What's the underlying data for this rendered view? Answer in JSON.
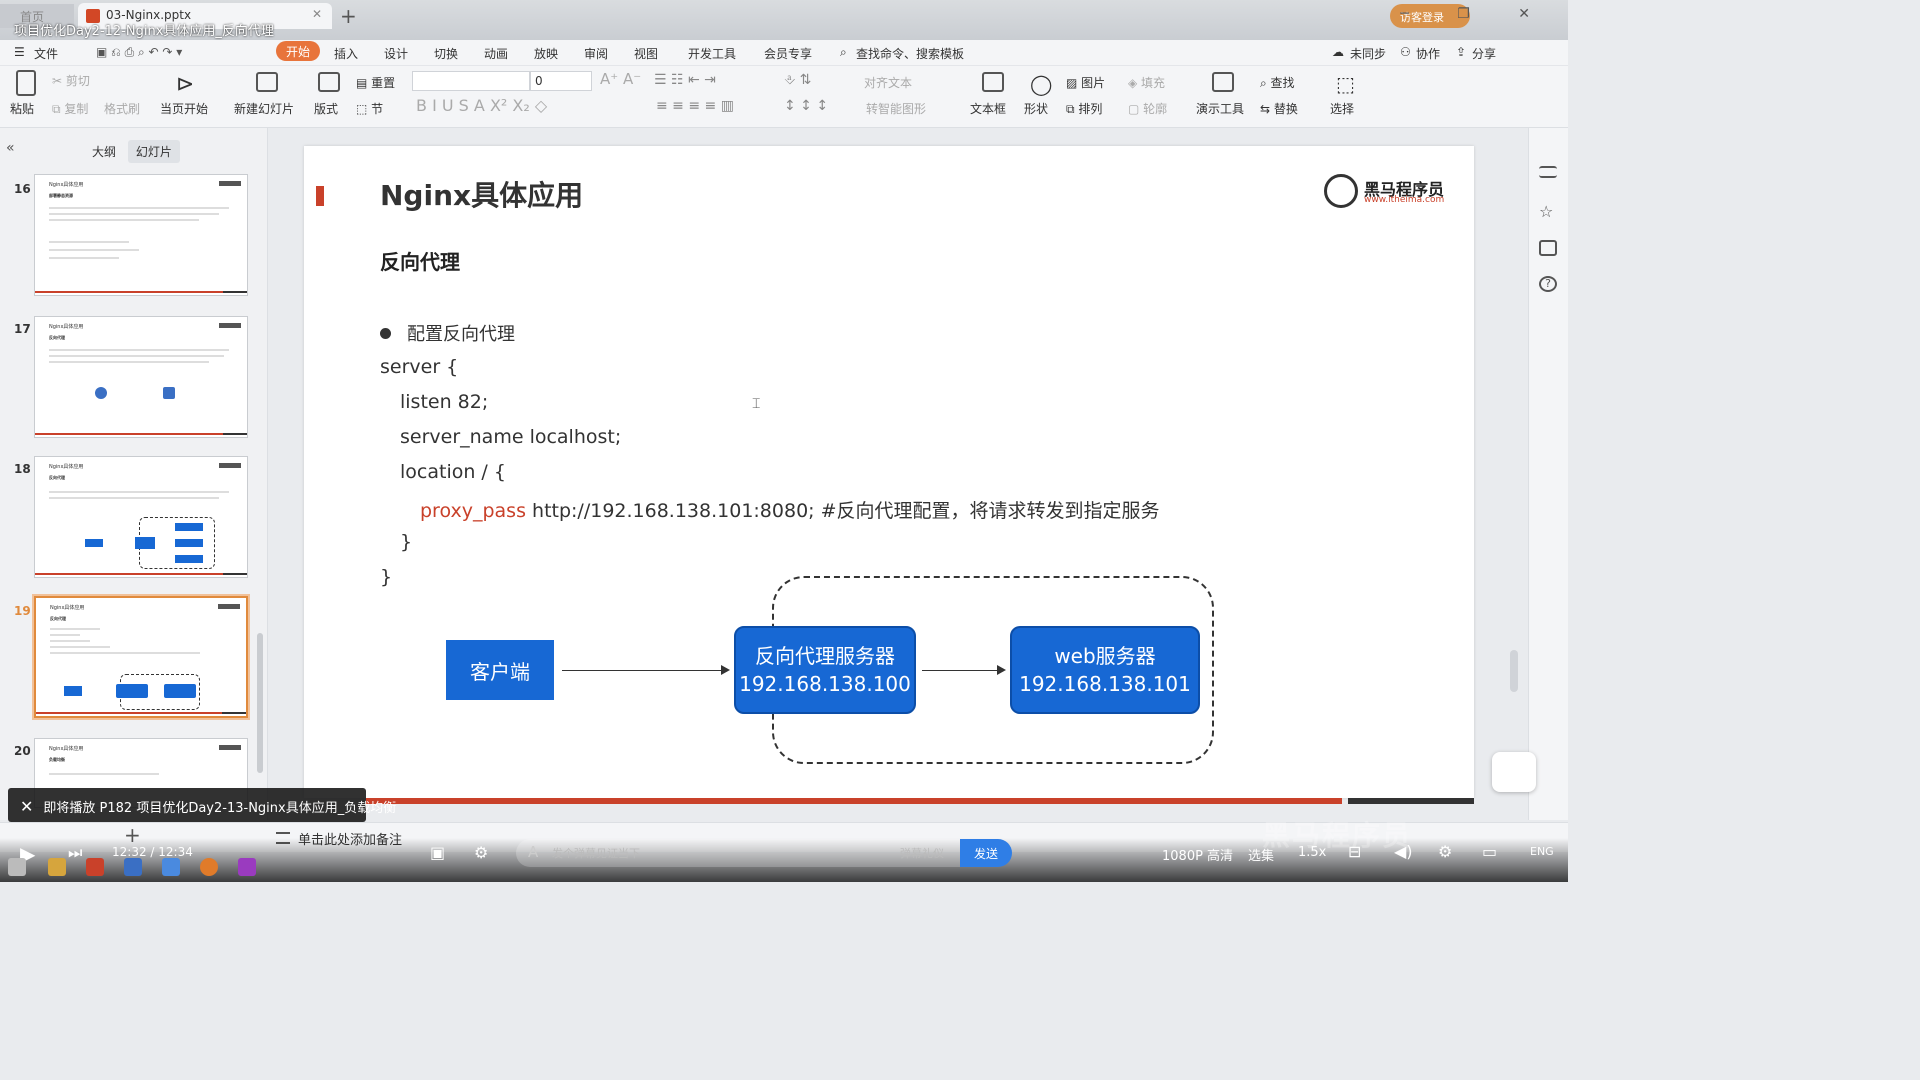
{
  "window": {
    "home_tab": "首页",
    "doc_tab": "03-Nginx.pptx",
    "title": "项目优化Day2-12-Nginx具体应用_反向代理",
    "login": "访客登录"
  },
  "menu": {
    "file": "文件",
    "tabs": [
      "开始",
      "插入",
      "设计",
      "切换",
      "动画",
      "放映",
      "审阅",
      "视图",
      "开发工具",
      "会员专享"
    ],
    "search": "查找命令、搜索模板",
    "sync": "未同步",
    "collab": "协作",
    "share": "分享"
  },
  "ribbon": {
    "paste": "粘贴",
    "cut": "剪切",
    "copy": "复制",
    "format_painter": "格式刷",
    "from_current": "当页开始",
    "new_slide": "新建幻灯片",
    "layout": "版式",
    "section": "节",
    "reset": "重置",
    "font_size": "0",
    "align_text": "对齐文本",
    "smart_shape": "转智能图形",
    "textbox": "文本框",
    "shape": "形状",
    "picture": "图片",
    "fill": "填充",
    "arrange": "排列",
    "outline": "轮廓",
    "present_tool": "演示工具",
    "find": "查找",
    "replace": "替换",
    "select": "选择"
  },
  "left_pane": {
    "tab_outline": "大纲",
    "tab_slides": "幻灯片",
    "thumbnails": [
      {
        "num": "16",
        "title": "Nginx具体应用",
        "sub": "部署静态资源"
      },
      {
        "num": "17",
        "title": "Nginx具体应用",
        "sub": "反向代理"
      },
      {
        "num": "18",
        "title": "Nginx具体应用",
        "sub": "反向代理"
      },
      {
        "num": "19",
        "title": "Nginx具体应用",
        "sub": "反向代理"
      },
      {
        "num": "20",
        "title": "Nginx具体应用",
        "sub": "负载均衡"
      }
    ]
  },
  "slide": {
    "title": "Nginx具体应用",
    "logo_name": "黑马程序员",
    "logo_url": "www.itheima.com",
    "subtitle": "反向代理",
    "bullet": "配置反向代理",
    "code": {
      "l1": "server {",
      "l2": "listen 82;",
      "l3": "server_name localhost;",
      "l4": "location / {",
      "l5_kw": "proxy_pass",
      "l5_rest": " http://192.168.138.101:8080; #反向代理配置，将请求转发到指定服务",
      "l6": "}",
      "l7": "}"
    },
    "diagram": {
      "client": "客户端",
      "proxy_name": "反向代理服务器",
      "proxy_ip": "192.168.138.100",
      "web_name": "web服务器",
      "web_ip": "192.168.138.101"
    }
  },
  "notes": {
    "placeholder": "单击此处添加备注"
  },
  "player": {
    "next_toast": "即将播放 P182 项目优化Day2-13-Nginx具体应用_负载均衡",
    "time": "12:32 / 12:34",
    "danmu_placeholder": "发个弹幕见证当下",
    "danmu_etiquette": "弹幕礼仪",
    "send": "发送",
    "quality": "1080P 高清",
    "episodes": "选集",
    "speed": "1.5x",
    "lang": "ENG",
    "watermark": "黑马程序员"
  },
  "colors": {
    "accent": "#e8743b",
    "slide_red": "#c9412a",
    "diagram_blue": "#1768d4"
  }
}
